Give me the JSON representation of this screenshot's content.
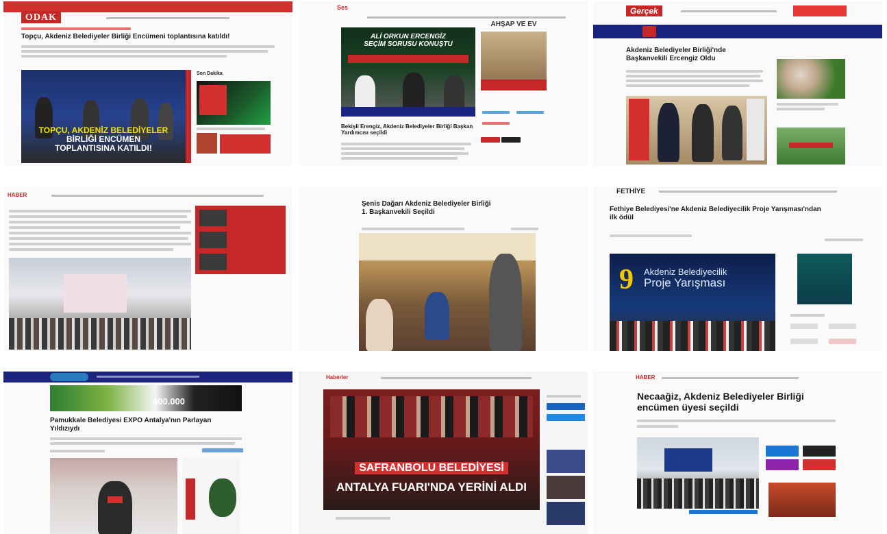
{
  "tiles": [
    {
      "id": "odak",
      "logo": "ODAK",
      "headline": "Topçu, Akdeniz Belediyeler Birliği Encümeni toplantısına katıldı!",
      "caption_line1": "TOPÇU, AKDENİZ BELEDİYELER",
      "caption_line2": "BİRLİĞİ ENCÜMEN",
      "caption_line3": "TOPLANTISINA KATILDI!",
      "side_title": "Son Dakika",
      "banner_colors": {
        "top": "#d32f2f",
        "caption": "#f2e500"
      }
    },
    {
      "id": "site2",
      "logo": "Ses",
      "banner_line1": "ALİ ORKUN ERCENGİZ",
      "banner_line2": "SEÇİM SORUSU KONUŞTU",
      "side_banner": "AHŞAP VE EV",
      "headline": "Bekişli Erengiz, Akdeniz Belediyeler Birliği Başkan Yardımcısı seçildi"
    },
    {
      "id": "gercek",
      "logo": "Gerçek",
      "headline_line1": "Akdeniz Belediyeler Birliği'nde",
      "headline_line2": "Başkanvekili Ercengiz Oldu"
    },
    {
      "id": "site4",
      "logo": "HABER"
    },
    {
      "id": "site5",
      "headline_line1": "Şenis Dağarı Akdeniz Belediyeler Birliği",
      "headline_line2": "1. Başkanvekili Seçildi"
    },
    {
      "id": "fethiye",
      "logo": "FETHİYE",
      "headline_line1": "Fethiye Belediyesi'ne Akdeniz Belediyecilik Proje Yarışması'ndan",
      "headline_line2": "ilk ödül",
      "banner_number": "9",
      "banner_line1": "Akdeniz Belediyecilik",
      "banner_line2": "Proje Yarışması"
    },
    {
      "id": "site7",
      "ad_amount": "400.000",
      "headline_line1": "Pamukkale Belediyesi EXPO Antalya'nın Parlayan",
      "headline_line2": "Yıldızıydı"
    },
    {
      "id": "site8",
      "logo": "Haberler",
      "caption_line1": "SAFRANBOLU BELEDİYESİ",
      "caption_line2": "ANTALYA FUARI'NDA YERİNİ ALDI"
    },
    {
      "id": "site9",
      "logo": "HABER",
      "headline_line1": "Necaağiz, Akdeniz Belediyeler Birliği",
      "headline_line2": "encümen üyesi seçildi"
    }
  ]
}
